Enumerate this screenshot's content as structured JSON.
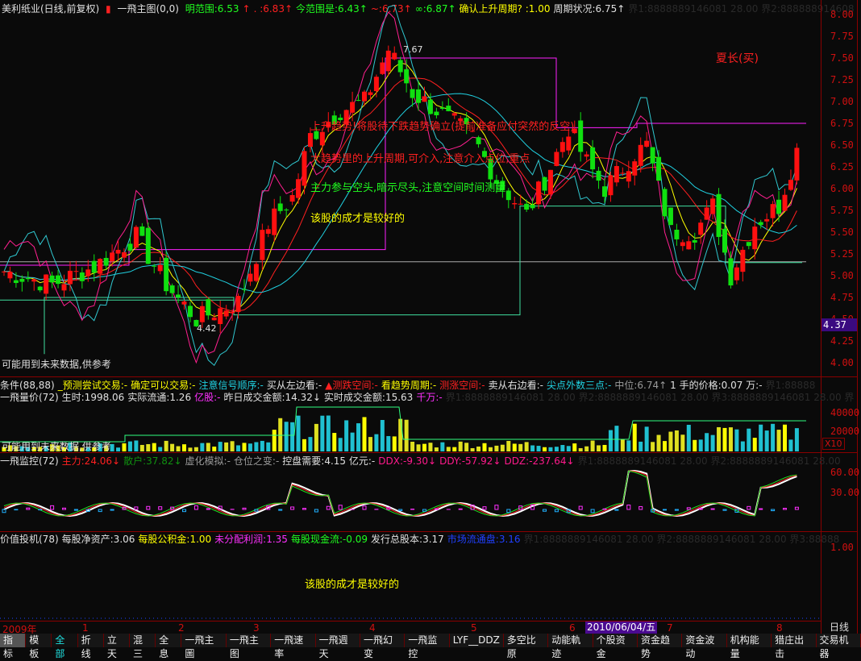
{
  "header": {
    "title": "美利纸业(日线,前复权)",
    "indicator": "一飛主图(0,0)",
    "items": [
      {
        "label": "明范围:6.53",
        "color": "g"
      },
      {
        "label": "↑",
        "color": "r"
      },
      {
        "label": ". :6.83↑",
        "color": "r"
      },
      {
        "label": "今范围是:6.43↑",
        "color": "g"
      },
      {
        "label": "~:6.73↑",
        "color": "r"
      },
      {
        "label": "∞:6.87↑",
        "color": "g"
      },
      {
        "label": "确认上升周期? :1.00",
        "color": "y"
      },
      {
        "label": "周期状况:6.75↑",
        "color": "w"
      },
      {
        "label": "界1:8888889146081 28.00  界2:888888914608",
        "color": "dk"
      }
    ]
  },
  "main": {
    "messages": {
      "m1": "上升趋势!将股待下跌趋势确立(提前准备应付突然的反空)",
      "m2": "大趋势里的上升周期,可介入,注意介入点位,重点",
      "m3": "主力参与空头,暗示尽头,注意空间时间测量",
      "m4": "该股的成才是较好的",
      "sign": "夏长(买)",
      "high": "7.67",
      "low": "4.42",
      "note": "可能用到未来数据,供参考"
    },
    "price_axis": [
      "8.00",
      "7.75",
      "7.50",
      "7.25",
      "7.00",
      "6.75",
      "6.50",
      "6.25",
      "6.00",
      "5.75",
      "5.50",
      "5.25",
      "5.00",
      "4.75",
      "4.50",
      "4.25",
      "4.00"
    ],
    "current_price": "4.37"
  },
  "cond": {
    "items": [
      {
        "label": "条件(88,88)",
        "color": "w"
      },
      {
        "label": "_预测尝试交易:-",
        "color": "y"
      },
      {
        "label": "确定可以交易:-",
        "color": "y"
      },
      {
        "label": "注意信号顺序:-",
        "color": "c"
      },
      {
        "label": "买从左边看:-",
        "color": "w"
      },
      {
        "label": "▲测跌空间:-",
        "color": "r"
      },
      {
        "label": "看趋势周期:-",
        "color": "y"
      },
      {
        "label": "测涨空间:-",
        "color": "r"
      },
      {
        "label": "卖从右边看:-",
        "color": "w"
      },
      {
        "label": "尖点外数三点:-",
        "color": "c"
      },
      {
        "label": "中位:6.74↑",
        "color": "gr"
      },
      {
        "label": "1 手的价格:0.07 万:-",
        "color": "w"
      },
      {
        "label": "界1:88888",
        "color": "dk"
      }
    ]
  },
  "volume": {
    "items": [
      {
        "label": "一飛量价(72)",
        "color": "w"
      },
      {
        "label": "生时:1998.06",
        "color": "w"
      },
      {
        "label": "实际流通:1.26",
        "color": "w"
      },
      {
        "label": "亿股:-",
        "color": "m"
      },
      {
        "label": "昨日成交金额:14.32↓",
        "color": "w"
      },
      {
        "label": "实时成交金额:15.63",
        "color": "w"
      },
      {
        "label": "千万:-",
        "color": "m"
      },
      {
        "label": "界1:8888889146081 28.00 界2:8888889146081 28.00 界3:8888889146081 28.00 界",
        "color": "dk"
      }
    ],
    "axis": [
      "40000",
      "20000"
    ],
    "mult": "X10",
    "note": "可能用到未来数据,供参考"
  },
  "monitor": {
    "items": [
      {
        "label": "一飛监控(72)",
        "color": "w"
      },
      {
        "label": "主力:24.06↓",
        "color": "r"
      },
      {
        "label": "散户:37.82↓",
        "color": "dg"
      },
      {
        "label": "虚化模拟:-",
        "color": "gr"
      },
      {
        "label": "仓位之变:-",
        "color": "gr"
      },
      {
        "label": "控盘需要:4.15 亿元:-",
        "color": "w"
      },
      {
        "label": "DDX:-9.30↓",
        "color": "pk"
      },
      {
        "label": "DDY:-57.92↓",
        "color": "pk"
      },
      {
        "label": "DDZ:-237.64↓",
        "color": "pk"
      },
      {
        "label": "界1:8888889146081 28.00 界2:8888889146081 28.00",
        "color": "dk"
      }
    ],
    "axis": [
      "60.00",
      "30.00"
    ]
  },
  "value": {
    "items": [
      {
        "label": "价值投机(78)",
        "color": "w"
      },
      {
        "label": "每股净资产:3.06",
        "color": "w"
      },
      {
        "label": "每股公积金:1.00",
        "color": "y"
      },
      {
        "label": "未分配利润:1.35",
        "color": "m"
      },
      {
        "label": "每股现金流:-0.09",
        "color": "g"
      },
      {
        "label": "发行总股本:3.17",
        "color": "w"
      },
      {
        "label": "市场流通盘:3.16",
        "color": "b"
      },
      {
        "label": "界1:8888889146081 28.00 界2:8888889146081 28.00 界3:88888",
        "color": "dk"
      }
    ],
    "axis": "1.00",
    "comment": "该股的成才是较好的"
  },
  "dates": {
    "year": "2009年",
    "months": [
      "1",
      "2",
      "3",
      "4",
      "5",
      "6",
      "7",
      "8"
    ],
    "cursor": "2010/06/04/五",
    "period": "日线"
  },
  "tabs": [
    "指标",
    "模板",
    "全部",
    "折线",
    "立天",
    "混三",
    "全息",
    "一飛主圖",
    "一飛主图",
    "一飛速率",
    "一飛週天",
    "一飛幻变",
    "一飛监控",
    "LYF__DDZ",
    "多空比原",
    "动能軌迹",
    "个股资金",
    "资金趋势",
    "资金波动",
    "机构能量",
    "猎庄出击",
    "交易机器"
  ],
  "chart_data": {
    "type": "candlestick",
    "candles": 133,
    "price_keypoints": [
      [
        0,
        5.05
      ],
      [
        8,
        4.9
      ],
      [
        15,
        5.1
      ],
      [
        22,
        5.45
      ],
      [
        27,
        4.9
      ],
      [
        32,
        4.5
      ],
      [
        39,
        4.7
      ],
      [
        44,
        5.6
      ],
      [
        48,
        5.9
      ],
      [
        51,
        6.6
      ],
      [
        56,
        6.9
      ],
      [
        60,
        7.0
      ],
      [
        64,
        7.6
      ],
      [
        68,
        7.1
      ],
      [
        72,
        6.9
      ],
      [
        78,
        6.6
      ],
      [
        82,
        6.1
      ],
      [
        87,
        5.7
      ],
      [
        90,
        6.1
      ],
      [
        94,
        6.7
      ],
      [
        97,
        6.3
      ],
      [
        100,
        6.0
      ],
      [
        105,
        6.4
      ],
      [
        107,
        6.5
      ],
      [
        111,
        5.5
      ],
      [
        115,
        5.5
      ],
      [
        118,
        5.8
      ],
      [
        121,
        5.0
      ],
      [
        125,
        5.6
      ],
      [
        129,
        5.8
      ],
      [
        133,
        6.65
      ]
    ],
    "ylim": [
      4.0,
      8.0
    ]
  }
}
